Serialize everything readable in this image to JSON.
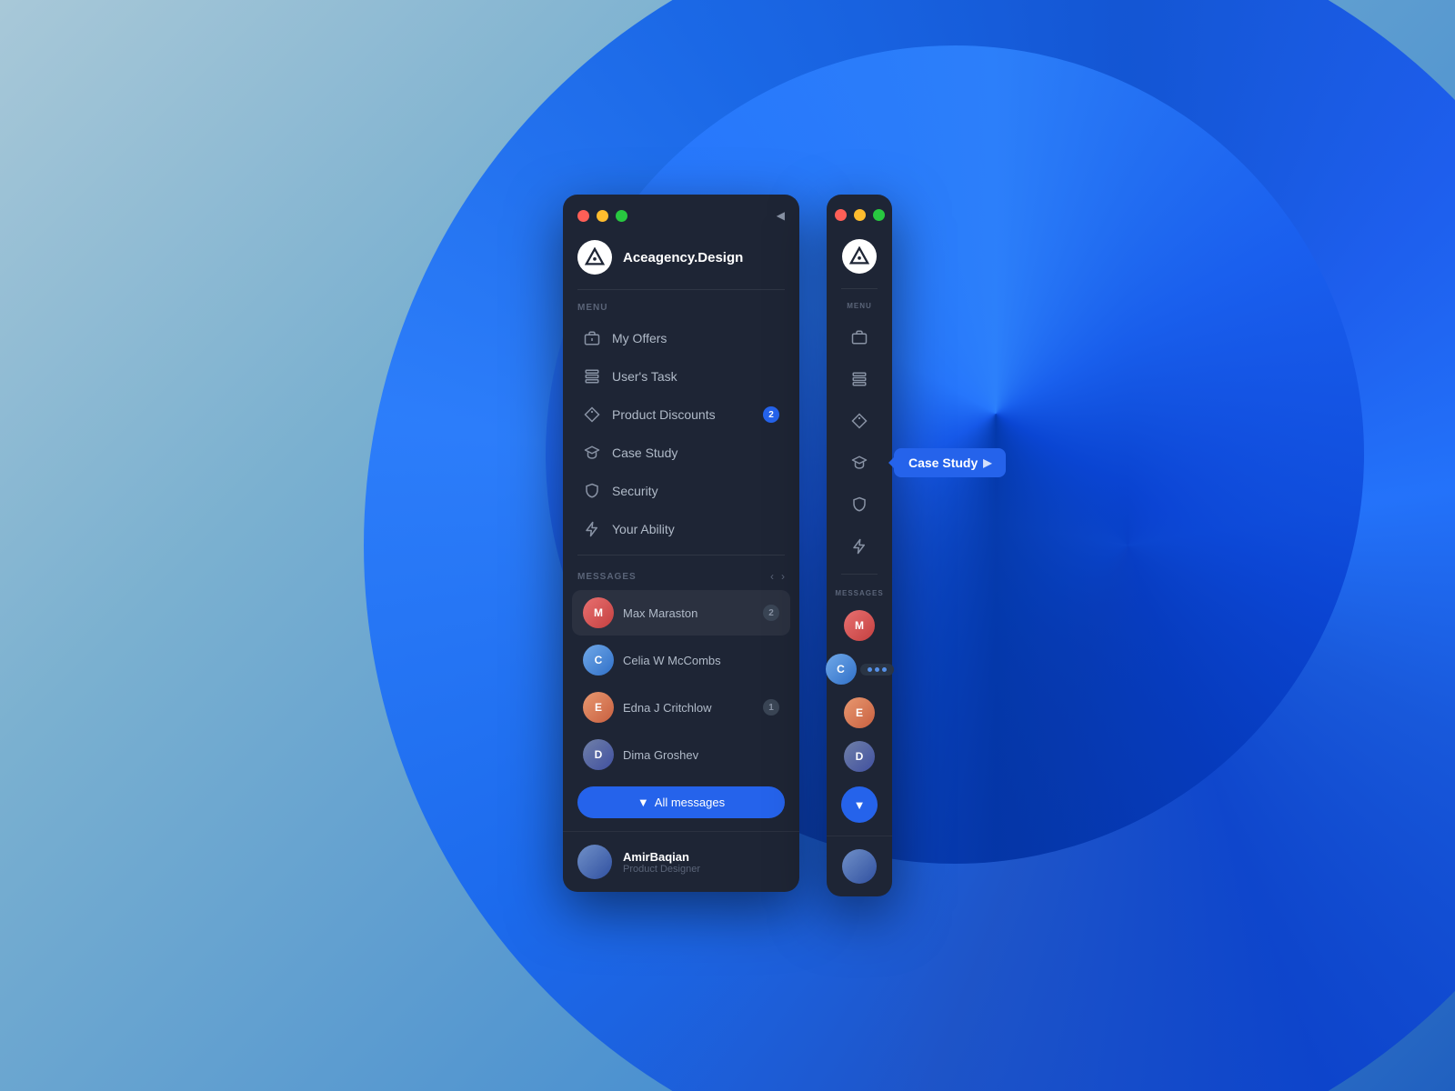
{
  "background": {
    "color_start": "#a8c8d8",
    "color_end": "#2060c0"
  },
  "expanded_sidebar": {
    "title": "Aceagency.Design",
    "traffic_lights": [
      "red",
      "yellow",
      "green"
    ],
    "menu_label": "MENU",
    "menu_items": [
      {
        "id": "my-offers",
        "label": "My Offers",
        "icon": "briefcase",
        "badge": null
      },
      {
        "id": "users-task",
        "label": "User's Task",
        "icon": "stack",
        "badge": null
      },
      {
        "id": "product-discounts",
        "label": "Product Discounts",
        "icon": "tag",
        "badge": "2"
      },
      {
        "id": "case-study",
        "label": "Case Study",
        "icon": "graduation",
        "badge": null
      },
      {
        "id": "security",
        "label": "Security",
        "icon": "shield",
        "badge": null
      },
      {
        "id": "your-ability",
        "label": "Your Ability",
        "icon": "bolt",
        "badge": null
      }
    ],
    "messages_label": "MESSAGES",
    "messages": [
      {
        "id": "max",
        "name": "Max Maraston",
        "badge": "2",
        "active": true,
        "avatar_color": "#e87070"
      },
      {
        "id": "celia",
        "name": "Celia W McCombs",
        "badge": null,
        "active": false,
        "avatar_color": "#70a8e8"
      },
      {
        "id": "edna",
        "name": "Edna J Critchlow",
        "badge": "1",
        "active": false,
        "avatar_color": "#e89870"
      },
      {
        "id": "dima",
        "name": "Dima Groshev",
        "badge": null,
        "active": false,
        "avatar_color": "#7080a8"
      }
    ],
    "all_messages_btn": "All messages",
    "user": {
      "name": "AmirBaqian",
      "role": "Product Designer"
    }
  },
  "collapsed_sidebar": {
    "traffic_lights": [
      "red",
      "yellow",
      "green"
    ],
    "menu_label": "MENU",
    "tooltip": {
      "label": "Case Study",
      "visible": true,
      "menu_item_index": 3
    },
    "messages_label": "MESSAGES",
    "messages": [
      {
        "id": "max",
        "avatar_color": "#e87070"
      },
      {
        "id": "celia",
        "avatar_color": "#70a8e8",
        "active_dots": true
      },
      {
        "id": "edna",
        "avatar_color": "#e89870"
      },
      {
        "id": "dima",
        "avatar_color": "#7080a8"
      }
    ]
  }
}
